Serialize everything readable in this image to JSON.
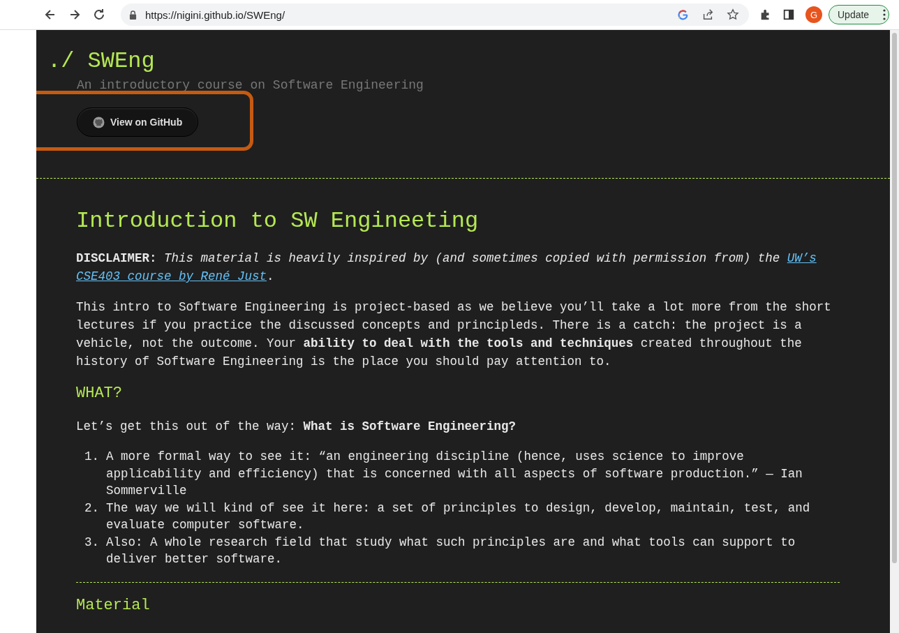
{
  "browser": {
    "url": "https://nigini.github.io/SWEng/",
    "avatar": "G",
    "update_button": "Update"
  },
  "header": {
    "prompt": "./",
    "title": "SWEng",
    "subtitle": "An introductory course on Software Engineering",
    "button": "View on GitHub",
    "highlighted": true
  },
  "content": {
    "title": "Introduction to SW Engineeting",
    "disclaimer": {
      "text": "**DISCLAIMER:** *This material is heavily inspired by (and sometimes copied with permission from) the*",
      "links": [
        "UW’s",
        "CSE403 course by René Just"
      ],
      "end": "."
    },
    "paragraph": "This intro to Software Engineering is project-based as we believe you’ll take a lot more from the short lectures if you practice the discussed concepts and principleds. There is a catch: the project is a vehicle, not the outcome. Your **ability to deal with the tools and techniques** created throughout the history of Software Engineering is the place you should pay attention to.",
    "sections": [
      {
        "heading": "WHAT?",
        "intro": "Let’s get this out of the way: **What is Software Engineering?**",
        "items": [
          {
            "number": "1.",
            "text": "A more formal way to see it: “an engineering discipline (hence, uses science to improve applicability and efficiency) that is concerned with all aspects of software production.” — Ian Sommerville"
          },
          {
            "number": "2.",
            "text": "The way we will kind of see it here: a set of principles to design, develop, maintain, test, and evaluate computer software."
          },
          {
            "number": "3.",
            "text": "Also: A whole research field that study what such principles are and what tools can support to deliver better software."
          }
        ]
      },
      {
        "heading": "Material"
      }
    ]
  }
}
